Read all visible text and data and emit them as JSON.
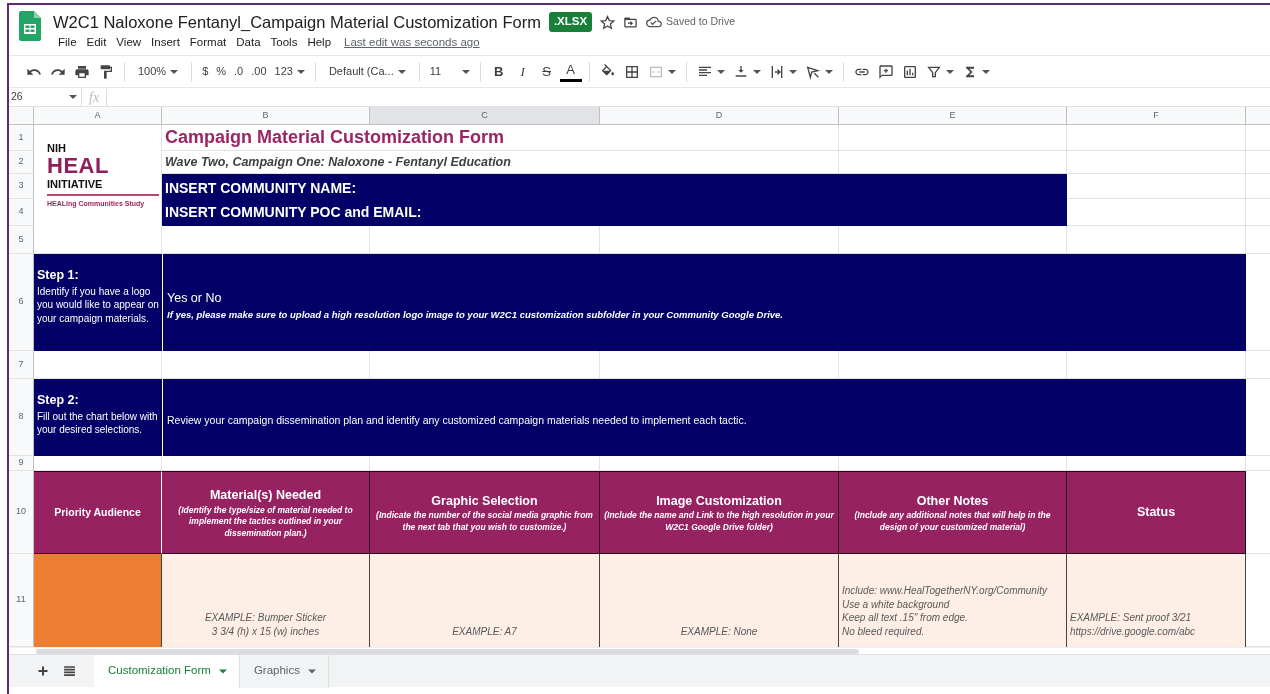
{
  "document": {
    "title": "W2C1 Naloxone Fentanyl_Campaign Material Customization Form",
    "file_badge": ".XLSX",
    "save_status": "Saved to Drive"
  },
  "menu": [
    "File",
    "Edit",
    "View",
    "Insert",
    "Format",
    "Data",
    "Tools",
    "Help"
  ],
  "last_edit": "Last edit was seconds ago",
  "toolbar": {
    "zoom": "100%",
    "currency": "$",
    "percent": "%",
    "decrease_decimal": ".0",
    "increase_decimal": ".00",
    "more_formats": "123",
    "font": "Default (Ca...",
    "font_size": "11",
    "bold": "B",
    "italic": "I",
    "strikethrough": "S",
    "text_color": "A"
  },
  "formula_bar": {
    "cell_ref": "26",
    "fx": "fx"
  },
  "columns": [
    "A",
    "B",
    "C",
    "D",
    "E",
    "F"
  ],
  "row_numbers": [
    "1",
    "2",
    "3",
    "4",
    "5",
    "6",
    "7",
    "8",
    "9",
    "10",
    "11"
  ],
  "sheet": {
    "logo": {
      "nih": "NIH",
      "heal": "HEAL",
      "initiative": "INITIATIVE",
      "study": "HEALing Communities Study"
    },
    "form_title": "Campaign Material Customization Form",
    "subtitle": "Wave Two, Campaign One: Naloxone - Fentanyl Education",
    "community_fields": [
      "INSERT COMMUNITY NAME:",
      "INSERT COMMUNITY POC and EMAIL:"
    ],
    "steps": [
      {
        "title": "Step 1:",
        "description": "Identify if you have a logo you would like to appear on your campaign materials.",
        "answer": "Yes or No",
        "note": "If yes, please make sure to upload a high resolution logo image to your W2C1 customization subfolder in your Community Google Drive."
      },
      {
        "title": "Step 2:",
        "description": "Fill out the chart below with your desired selections.",
        "note": "Review your campaign dissemination plan and identify any customized campaign materials needed to implement each tactic."
      }
    ],
    "table": {
      "columns": [
        {
          "title": "Priority Audience"
        },
        {
          "title": "Material(s) Needed",
          "hint": "(Identify the type/size of material needed to implement the tactics outlined in your dissemination plan.)"
        },
        {
          "title": "Graphic Selection",
          "hint": "(Indicate the number of the social media graphic from the next tab that you wish to customize.)"
        },
        {
          "title": "Image Customization",
          "hint": "(Include the name and Link to the high resolution in your W2C1 Google Drive folder)"
        },
        {
          "title": "Other Notes",
          "hint": "(Include any additional notes that will help in the design of your customized material)"
        },
        {
          "title": "Status"
        }
      ],
      "example_row": [
        {
          "kind": "swatch"
        },
        {
          "kind": "text",
          "text": "EXAMPLE: Bumper Sticker\n3 3/4 (h) x 15 (w) inches"
        },
        {
          "kind": "text",
          "text": "EXAMPLE: A7"
        },
        {
          "kind": "text",
          "text": "EXAMPLE: None"
        },
        {
          "kind": "text",
          "text": "Include: www.HealTogetherNY.org/Community\nUse a white background\nKeep all text .15\" from edge.\nNo bleed required."
        },
        {
          "kind": "text",
          "text": "EXAMPLE: Sent proof 3/21\nhttps://drive.google.com/abc"
        }
      ]
    }
  },
  "sheet_tabs": [
    {
      "label": "Customization Form",
      "selected": true
    },
    {
      "label": "Graphics",
      "selected": false
    }
  ]
}
